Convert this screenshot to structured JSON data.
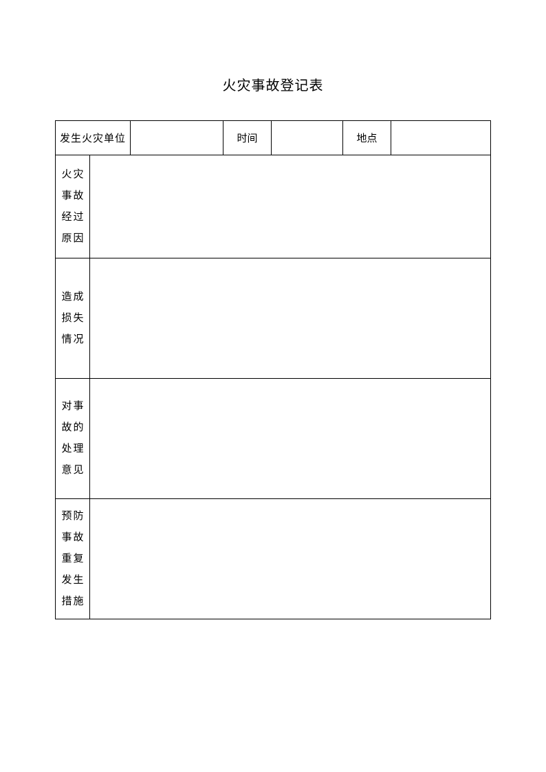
{
  "title": "火灾事故登记表",
  "header": {
    "unit_label": "发生火灾单位",
    "unit_value": "",
    "time_label": "时间",
    "time_value": "",
    "place_label": "地点",
    "place_value": ""
  },
  "sections": {
    "process": {
      "label_chars": [
        "火灾",
        "事故",
        "经过",
        "原因"
      ],
      "value": ""
    },
    "damage": {
      "label_chars": [
        "造成",
        "损失",
        "情况"
      ],
      "value": ""
    },
    "opinion": {
      "label_chars": [
        "对事",
        "故的",
        "处理",
        "意见"
      ],
      "value": ""
    },
    "prevention": {
      "label_chars": [
        "预防",
        "事故",
        "重复",
        "发生",
        "措施"
      ],
      "value": ""
    }
  }
}
